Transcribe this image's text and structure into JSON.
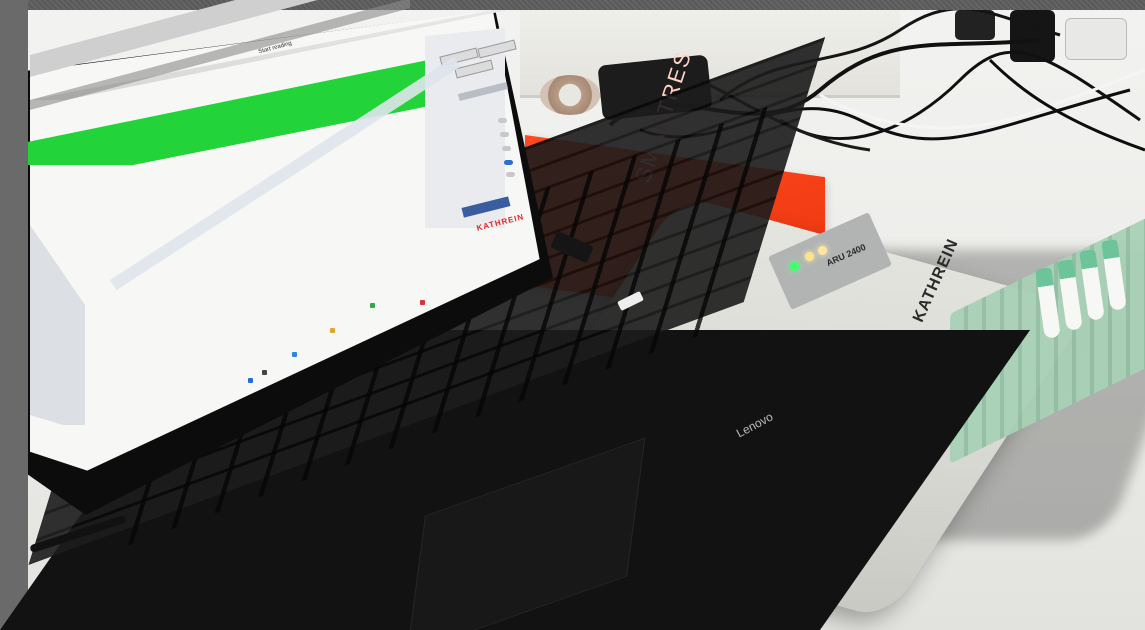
{
  "scene": {
    "laptop_brand": "Lenovo",
    "reader_brand": "KATHREIN",
    "reader_model": "ARU 2400",
    "box_text": "SMARTRES",
    "app_title": "Start reading",
    "screen_logo": "KATHREIN"
  },
  "colors": {
    "highlight_green": "#22d43a",
    "orange_box": "#f04018",
    "led_green": "#3cff6a",
    "logo_red": "#e32626"
  },
  "icons": [
    "laptop-icon",
    "rfid-reader-icon",
    "test-tube-icon",
    "cable-icon",
    "windows-icon"
  ]
}
